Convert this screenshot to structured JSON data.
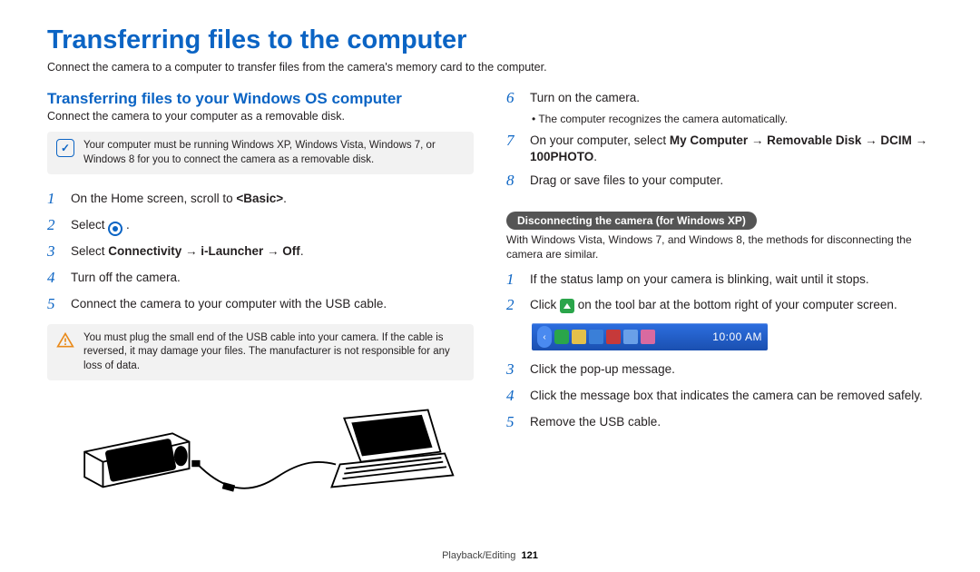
{
  "title": "Transferring files to the computer",
  "intro": "Connect the camera to a computer to transfer files from the camera's memory card to the computer.",
  "left": {
    "subhead": "Transferring files to your Windows OS computer",
    "subtext": "Connect the camera to your computer as a removable disk.",
    "note": "Your computer must be running Windows XP, Windows Vista, Windows 7, or Windows 8 for you to connect the camera as a removable disk.",
    "steps": {
      "s1": {
        "text_a": "On the Home screen, scroll to ",
        "bold": "<Basic>",
        "text_b": "."
      },
      "s2": {
        "text_a": "Select ",
        "text_b": " ."
      },
      "s3": {
        "text_a": "Select ",
        "bold": "Connectivity → i-Launcher → Off",
        "text_b": "."
      },
      "s4": {
        "text": "Turn off the camera."
      },
      "s5": {
        "text": "Connect the camera to your computer with the USB cable."
      }
    },
    "warn": "You must plug the small end of the USB cable into your camera. If the cable is reversed, it may damage your files. The manufacturer is not responsible for any loss of data."
  },
  "right": {
    "steps6_8": {
      "s6": {
        "text": "Turn on the camera.",
        "sub": "The computer recognizes the camera automatically."
      },
      "s7": {
        "text_a": "On your computer, select ",
        "bold": "My Computer → Removable Disk → DCIM → 100PHOTO",
        "text_b": "."
      },
      "s8": {
        "text": "Drag or save files to your computer."
      }
    },
    "disconnect": {
      "heading": "Disconnecting the camera (for Windows XP)",
      "sub": "With Windows Vista, Windows 7, and Windows 8, the methods for disconnecting the camera are similar.",
      "s1": {
        "text": "If the status lamp on your camera is blinking, wait until it stops."
      },
      "s2": {
        "text_a": "Click ",
        "text_b": " on the tool bar at the bottom right of your computer screen."
      },
      "s3": {
        "text": "Click the pop-up message."
      },
      "s4": {
        "text": "Click the message box that indicates the camera can be removed safely."
      },
      "s5": {
        "text": "Remove the USB cable."
      }
    },
    "taskbar_time": "10:00 AM"
  },
  "footer": {
    "section": "Playback/Editing",
    "page": "121"
  }
}
